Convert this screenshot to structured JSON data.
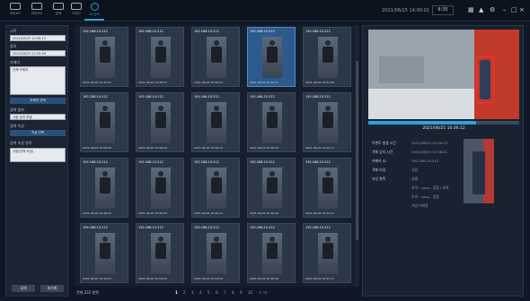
{
  "topnav": [
    {
      "label": "라이브1"
    },
    {
      "label": "라이브2"
    },
    {
      "label": "검색"
    },
    {
      "label": "드래그"
    },
    {
      "label": "AI 검색"
    }
  ],
  "status": {
    "date": "2021/06/25 14:00:01",
    "time": "8:35"
  },
  "left": {
    "start_label": "시작",
    "start_value": "2021/06/25 10:56:15",
    "end_label": "종료",
    "end_value": "2021/06/25 22:55:56",
    "camera_label": "카메라",
    "camera_value": "전체 카메라",
    "camera_btn": "카메라 선택",
    "range_label": "검색 범위",
    "range_value": "사람 검색 모델",
    "target_label": "검색 속성",
    "target_btn": "속성 선택",
    "result_label": "검색 속성 항목",
    "result_value": "사람(전체 속성)",
    "search_btn": "검색",
    "init_btn": "초기화"
  },
  "cards": [
    {
      "id": "192.168.10.212",
      "ts": "2021-06-25 10:43:43"
    },
    {
      "id": "192.168.10.212",
      "ts": "2021-06-25 10:48:33"
    },
    {
      "id": "192.168.10.212",
      "ts": "2021-06-25 10:56:23"
    },
    {
      "id": "192.168.10.212",
      "ts": "2021-06-25 10:56:21"
    },
    {
      "id": "192.168.10.212",
      "ts": "2021-06-25 10:51:38"
    },
    {
      "id": "192.168.10.212",
      "ts": "2021-06-25 10:56:09"
    },
    {
      "id": "192.168.10.212",
      "ts": "2021-06-25 10:56:09"
    },
    {
      "id": "192.168.10.212",
      "ts": "2021-06-25 10:56:16"
    },
    {
      "id": "192.168.10.212",
      "ts": "2021-06-25 10:58:33"
    },
    {
      "id": "192.168.10.212",
      "ts": "2021-06-25 10:54:11"
    },
    {
      "id": "192.168.10.212",
      "ts": "2021-06-25 10:48:15"
    },
    {
      "id": "192.168.10.212",
      "ts": "2021-06-25 10:56:09"
    },
    {
      "id": "192.168.10.212",
      "ts": "2021-06-25 10:55:14"
    },
    {
      "id": "192.168.10.212",
      "ts": "2021-06-25 10:56:29"
    },
    {
      "id": "192.168.10.212",
      "ts": "2021-06-25 10:54:11"
    },
    {
      "id": "192.168.10.212",
      "ts": "2021-06-25 10:43:03"
    },
    {
      "id": "192.168.10.212",
      "ts": "2021-06-25 10:54:20"
    },
    {
      "id": "192.168.10.212",
      "ts": "2021-06-25 10:54:16"
    },
    {
      "id": "192.168.10.212",
      "ts": "2021-06-25 10:48:09"
    },
    {
      "id": "192.168.10.212",
      "ts": "2021-06-25 10:43:11"
    }
  ],
  "pager": {
    "total": "전체 232 항목",
    "pages": [
      "1",
      "2",
      "3",
      "4",
      "5",
      "6",
      "7",
      "8",
      "9",
      "10"
    ],
    "next": "> >|"
  },
  "right": {
    "video_date": "2021/06/25 10:36:12",
    "info": [
      {
        "k": "이벤트 발생 시간",
        "v": "2021/06/25 10:36:13"
      },
      {
        "k": "객체 감지 시간",
        "v": "2021/06/25 10:36:11"
      },
      {
        "k": "카메라 ID",
        "v": "192.168.10.212"
      },
      {
        "k": "객체 타입",
        "v": "사람"
      },
      {
        "k": "속성 항목",
        "v": "성별"
      },
      {
        "k": "",
        "v": "상의 : Long - 검정 / 회색"
      },
      {
        "k": "",
        "v": "하의 : Long - 검정"
      },
      {
        "k": "",
        "v": "가방 미착용"
      }
    ]
  }
}
